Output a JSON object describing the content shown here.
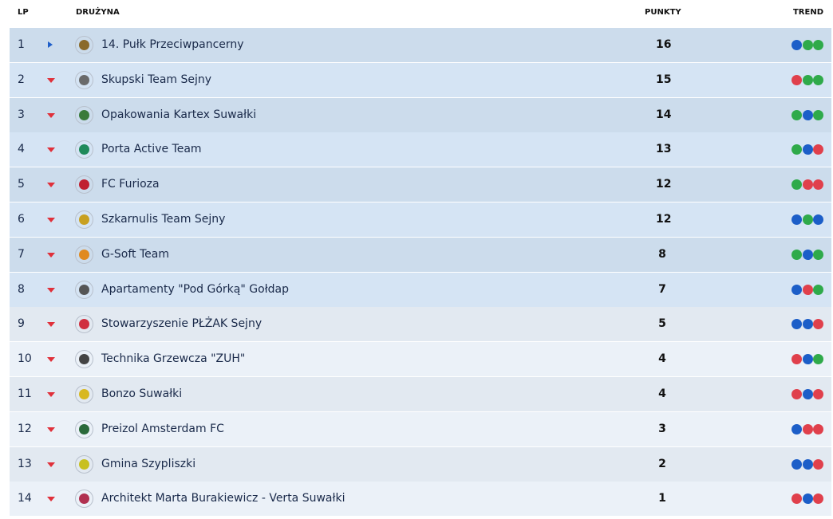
{
  "header": {
    "lp": "LP",
    "team": "DRUŻYNA",
    "points": "PUNKTY",
    "trend": "TREND"
  },
  "colors": {
    "win": "#2faa4a",
    "draw": "#1c5ec8",
    "loss": "#e0404c",
    "up_arrow": "#1f5fc9",
    "down_arrow": "#e0303a"
  },
  "rows": [
    {
      "pos": "1",
      "change": "right",
      "logo": "shield-logo-icon",
      "logo_color": "#8a6a2a",
      "team": "14. Pułk Przeciwpancerny",
      "points": "16",
      "trend": [
        "draw",
        "win",
        "win"
      ]
    },
    {
      "pos": "2",
      "change": "down",
      "logo": "badge-logo-icon",
      "logo_color": "#6a6a6a",
      "team": "Skupski Team Sejny",
      "points": "15",
      "trend": [
        "loss",
        "win",
        "win"
      ]
    },
    {
      "pos": "3",
      "change": "down",
      "logo": "badge-logo-icon",
      "logo_color": "#3a7a3a",
      "team": "Opakowania Kartex Suwałki",
      "points": "14",
      "trend": [
        "win",
        "draw",
        "win"
      ]
    },
    {
      "pos": "4",
      "change": "down",
      "logo": "badge-logo-icon",
      "logo_color": "#1f8a5a",
      "team": "Porta Active Team",
      "points": "13",
      "trend": [
        "win",
        "draw",
        "loss"
      ]
    },
    {
      "pos": "5",
      "change": "down",
      "logo": "badge-logo-icon",
      "logo_color": "#c02030",
      "team": "FC Furioza",
      "points": "12",
      "trend": [
        "win",
        "loss",
        "loss"
      ]
    },
    {
      "pos": "6",
      "change": "down",
      "logo": "badge-logo-icon",
      "logo_color": "#c8a020",
      "team": "Szkarnulis Team Sejny",
      "points": "12",
      "trend": [
        "draw",
        "win",
        "draw"
      ]
    },
    {
      "pos": "7",
      "change": "down",
      "logo": "badge-logo-icon",
      "logo_color": "#e08a20",
      "team": "G-Soft Team",
      "points": "8",
      "trend": [
        "win",
        "draw",
        "win"
      ]
    },
    {
      "pos": "8",
      "change": "down",
      "logo": "badge-logo-icon",
      "logo_color": "#555555",
      "team": "Apartamenty \"Pod Górką\" Gołdap",
      "points": "7",
      "trend": [
        "draw",
        "loss",
        "win"
      ]
    },
    {
      "pos": "9",
      "change": "down",
      "logo": "badge-logo-icon",
      "logo_color": "#d03040",
      "team": "Stowarzyszenie PŁŻAK Sejny",
      "points": "5",
      "trend": [
        "draw",
        "draw",
        "loss"
      ]
    },
    {
      "pos": "10",
      "change": "down",
      "logo": "badge-logo-icon",
      "logo_color": "#444444",
      "team": "Technika Grzewcza \"ZUH\"",
      "points": "4",
      "trend": [
        "loss",
        "draw",
        "win"
      ]
    },
    {
      "pos": "11",
      "change": "down",
      "logo": "badge-logo-icon",
      "logo_color": "#d8b820",
      "team": "Bonzo Suwałki",
      "points": "4",
      "trend": [
        "loss",
        "draw",
        "loss"
      ]
    },
    {
      "pos": "12",
      "change": "down",
      "logo": "badge-logo-icon",
      "logo_color": "#2a6a3a",
      "team": "Preizol Amsterdam FC",
      "points": "3",
      "trend": [
        "draw",
        "loss",
        "loss"
      ]
    },
    {
      "pos": "13",
      "change": "down",
      "logo": "badge-logo-icon",
      "logo_color": "#c8c020",
      "team": "Gmina Szypliszki",
      "points": "2",
      "trend": [
        "draw",
        "draw",
        "loss"
      ]
    },
    {
      "pos": "14",
      "change": "down",
      "logo": "badge-logo-icon",
      "logo_color": "#b03050",
      "team": "Architekt Marta Burakiewicz - Verta Suwałki",
      "points": "1",
      "trend": [
        "loss",
        "draw",
        "loss"
      ]
    }
  ]
}
